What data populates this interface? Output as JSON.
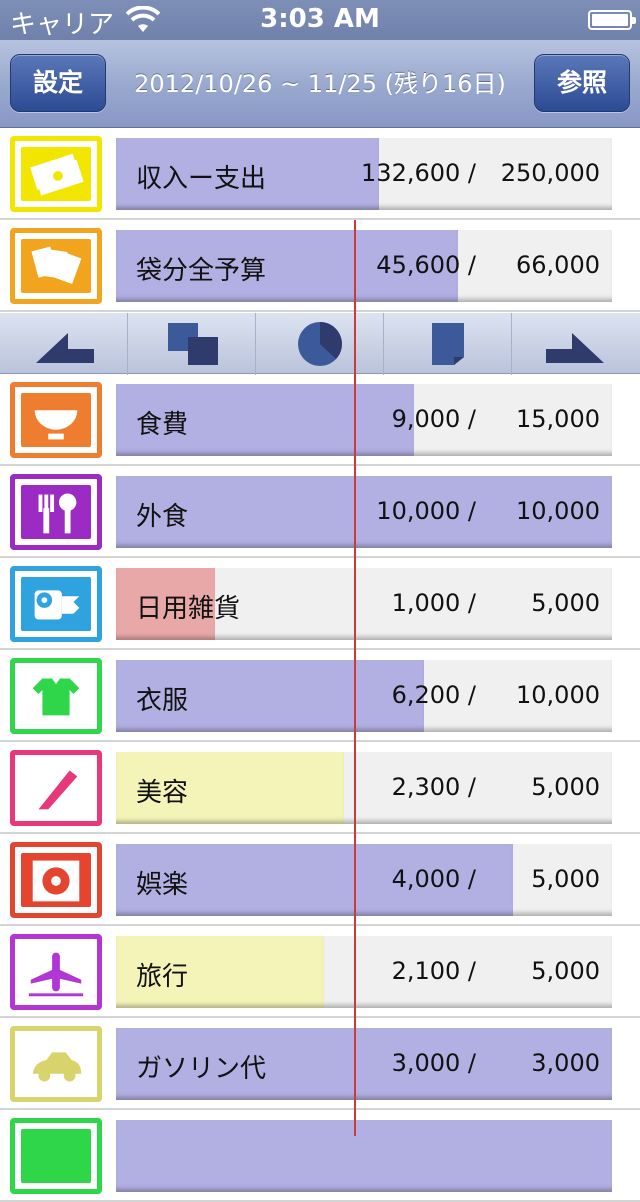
{
  "status": {
    "carrier": "キャリア",
    "time": "3:03 AM"
  },
  "nav": {
    "left_label": "設定",
    "title": "2012/10/26 ~ 11/25 (残り16日)",
    "right_label": "参照"
  },
  "chart_buttons": [
    {
      "icon": "left-triangle-icon"
    },
    {
      "icon": "overlapping-squares-icon"
    },
    {
      "icon": "pie-chart-icon"
    },
    {
      "icon": "folded-page-icon"
    },
    {
      "icon": "right-triangle-icon"
    }
  ],
  "rows": [
    {
      "label": "収入ー支出",
      "used": "132,600 /",
      "budget": "250,000",
      "progress": 0.53,
      "fill": "purple",
      "icon": "money-icon",
      "icon_color": "#f2e600"
    },
    {
      "label": "袋分全予算",
      "used": "45,600 /",
      "budget": "66,000",
      "progress": 0.69,
      "fill": "purple",
      "icon": "envelopes-icon",
      "icon_color": "#f3a41e"
    },
    {
      "label": "食費",
      "used": "9,000 /",
      "budget": "15,000",
      "progress": 0.6,
      "fill": "purple",
      "icon": "rice-bowl-icon",
      "icon_color": "#ef7d30"
    },
    {
      "label": "外食",
      "used": "10,000 /",
      "budget": "10,000",
      "progress": 1.0,
      "fill": "purple",
      "icon": "cutlery-icon",
      "icon_color": "#9b2bc2"
    },
    {
      "label": "日用雑貨",
      "used": "1,000 /",
      "budget": "5,000",
      "progress": 0.2,
      "fill": "red",
      "icon": "toilet-paper-icon",
      "icon_color": "#2ea3e0"
    },
    {
      "label": "衣服",
      "used": "6,200 /",
      "budget": "10,000",
      "progress": 0.62,
      "fill": "purple",
      "icon": "tshirt-icon",
      "icon_color": "#2fd64a"
    },
    {
      "label": "美容",
      "used": "2,300 /",
      "budget": "5,000",
      "progress": 0.46,
      "fill": "yellow",
      "icon": "razor-icon",
      "icon_color": "#e8377b"
    },
    {
      "label": "娯楽",
      "used": "4,000 /",
      "budget": "5,000",
      "progress": 0.8,
      "fill": "purple",
      "icon": "cd-icon",
      "icon_color": "#e4452f"
    },
    {
      "label": "旅行",
      "used": "2,100 /",
      "budget": "5,000",
      "progress": 0.42,
      "fill": "yellow",
      "icon": "airplane-icon",
      "icon_color": "#b236d6"
    },
    {
      "label": "ガソリン代",
      "used": "3,000 /",
      "budget": "3,000",
      "progress": 1.0,
      "fill": "purple",
      "icon": "car-icon",
      "icon_color": "#d8d36a"
    },
    {
      "label": "",
      "used": "",
      "budget": "",
      "progress": 1.0,
      "fill": "purple",
      "icon": "partial-icon",
      "icon_color": "#2fd64a"
    }
  ]
}
